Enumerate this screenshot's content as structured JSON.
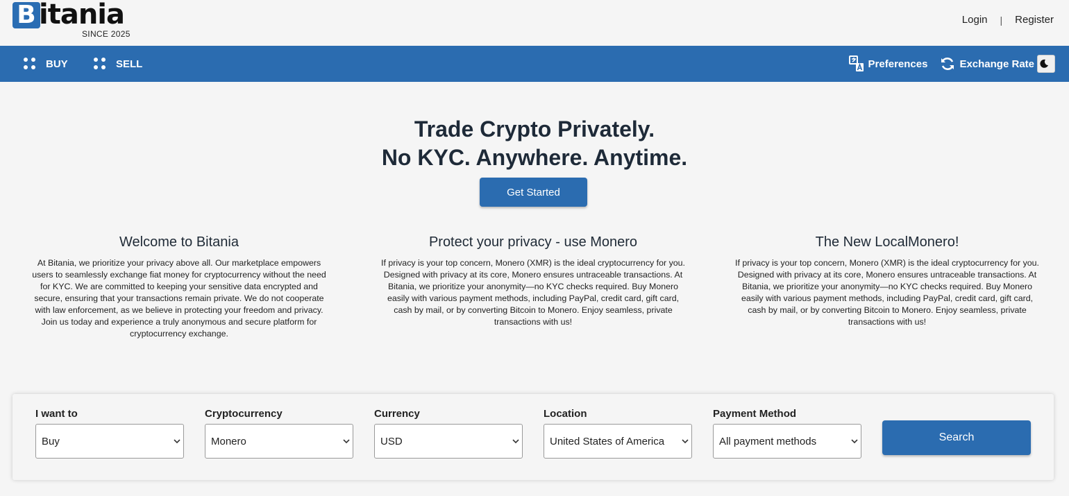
{
  "brand": {
    "logo_letter": "B",
    "logo_word": "itania",
    "since": "SINCE 2025",
    "accent": "#2b6cb0"
  },
  "auth": {
    "login": "Login",
    "separator": "|",
    "register": "Register"
  },
  "nav": {
    "buy": "BUY",
    "sell": "SELL",
    "preferences": "Preferences",
    "exchange_rate": "Exchange Rate"
  },
  "hero": {
    "line1": "Trade Crypto Privately.",
    "line2": "No KYC. Anywhere. Anytime.",
    "cta": "Get Started"
  },
  "columns": [
    {
      "title": "Welcome to Bitania",
      "body": "At Bitania, we prioritize your privacy above all. Our marketplace empowers users to seamlessly exchange fiat money for cryptocurrency without the need for KYC. We are committed to keeping your sensitive data encrypted and secure, ensuring that your transactions remain private. We do not cooperate with law enforcement, as we believe in protecting your freedom and privacy. Join us today and experience a truly anonymous and secure platform for cryptocurrency exchange."
    },
    {
      "title": "Protect your privacy - use Monero",
      "body": "If privacy is your top concern, Monero (XMR) is the ideal cryptocurrency for you. Designed with privacy at its core, Monero ensures untraceable transactions. At Bitania, we prioritize your anonymity—no KYC checks required. Buy Monero easily with various payment methods, including PayPal, credit card, gift card, cash by mail, or by converting Bitcoin to Monero. Enjoy seamless, private transactions with us!"
    },
    {
      "title": "The New LocalMonero!",
      "body": "If privacy is your top concern, Monero (XMR) is the ideal cryptocurrency for you. Designed with privacy at its core, Monero ensures untraceable transactions. At Bitania, we prioritize your anonymity—no KYC checks required. Buy Monero easily with various payment methods, including PayPal, credit card, gift card, cash by mail, or by converting Bitcoin to Monero. Enjoy seamless, private transactions with us!"
    }
  ],
  "search": {
    "fields": [
      {
        "label": "I want to",
        "value": "Buy"
      },
      {
        "label": "Cryptocurrency",
        "value": "Monero"
      },
      {
        "label": "Currency",
        "value": "USD"
      },
      {
        "label": "Location",
        "value": "United States of America"
      },
      {
        "label": "Payment Method",
        "value": "All payment methods"
      }
    ],
    "button": "Search"
  }
}
